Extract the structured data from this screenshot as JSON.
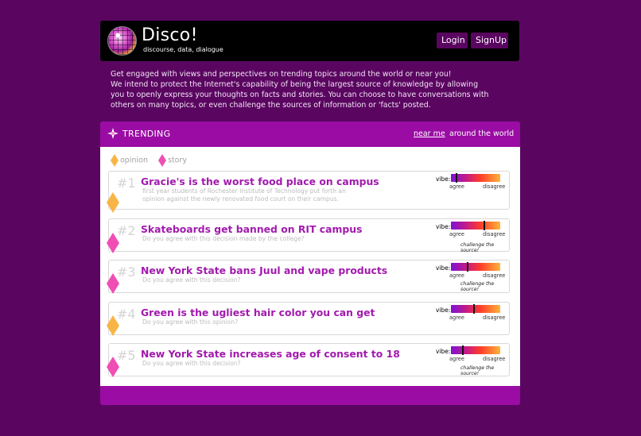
{
  "header": {
    "title": "Disco!",
    "subtitle": "discourse, data, dialogue",
    "login_label": "Login",
    "signup_label": "SignUp"
  },
  "intro": {
    "line1": "Get engaged with views and perspectives on trending topics around the world or near you!",
    "line2": "We intend to protect the Internet's capability of being the largest source of knowledge by allowing you to openly express your thoughts on facts and stories. You can choose to have conversations with others on many topics, or even challenge the sources of information or 'facts' posted."
  },
  "trending": {
    "title": "TRENDING",
    "near_me": "near me",
    "around_world": "around the world",
    "legend": {
      "opinion": "opinion",
      "story": "story"
    },
    "vibe_label": "vibe:",
    "agree_label": "agree",
    "disagree_label": "disagree",
    "challenge_label": "challenge the source!",
    "items": [
      {
        "rank": "#1",
        "title": "Gracie's is the worst food place on campus",
        "subtitle": "first year students of Rochester Institute of Technology put forth an opinion against the newly renovated food court on their campus.",
        "kind": "opinion",
        "vibe": 0.1
      },
      {
        "rank": "#2",
        "title": "Skateboards get banned on RIT campus",
        "subtitle": "Do you agree with this decision made by the college?",
        "kind": "story",
        "vibe": 0.68
      },
      {
        "rank": "#3",
        "title": "New York State bans Juul and vape products",
        "subtitle": "Do you agree with this decision?",
        "kind": "story",
        "vibe": 0.33
      },
      {
        "rank": "#4",
        "title": "Green is the ugliest hair color you can get",
        "subtitle": "Do you agree with this opinion?",
        "kind": "opinion",
        "vibe": 0.46
      },
      {
        "rank": "#5",
        "title": "New York State increases age of consent to 18",
        "subtitle": "Do you agree with this decision?",
        "kind": "story",
        "vibe": 0.24
      }
    ]
  },
  "colors": {
    "page_bg": "#5a0660",
    "trend_bg": "#9a0ca3",
    "title_color": "#a21aae",
    "opinion_color": "#f8b547",
    "story_color": "#ef4fb4"
  }
}
